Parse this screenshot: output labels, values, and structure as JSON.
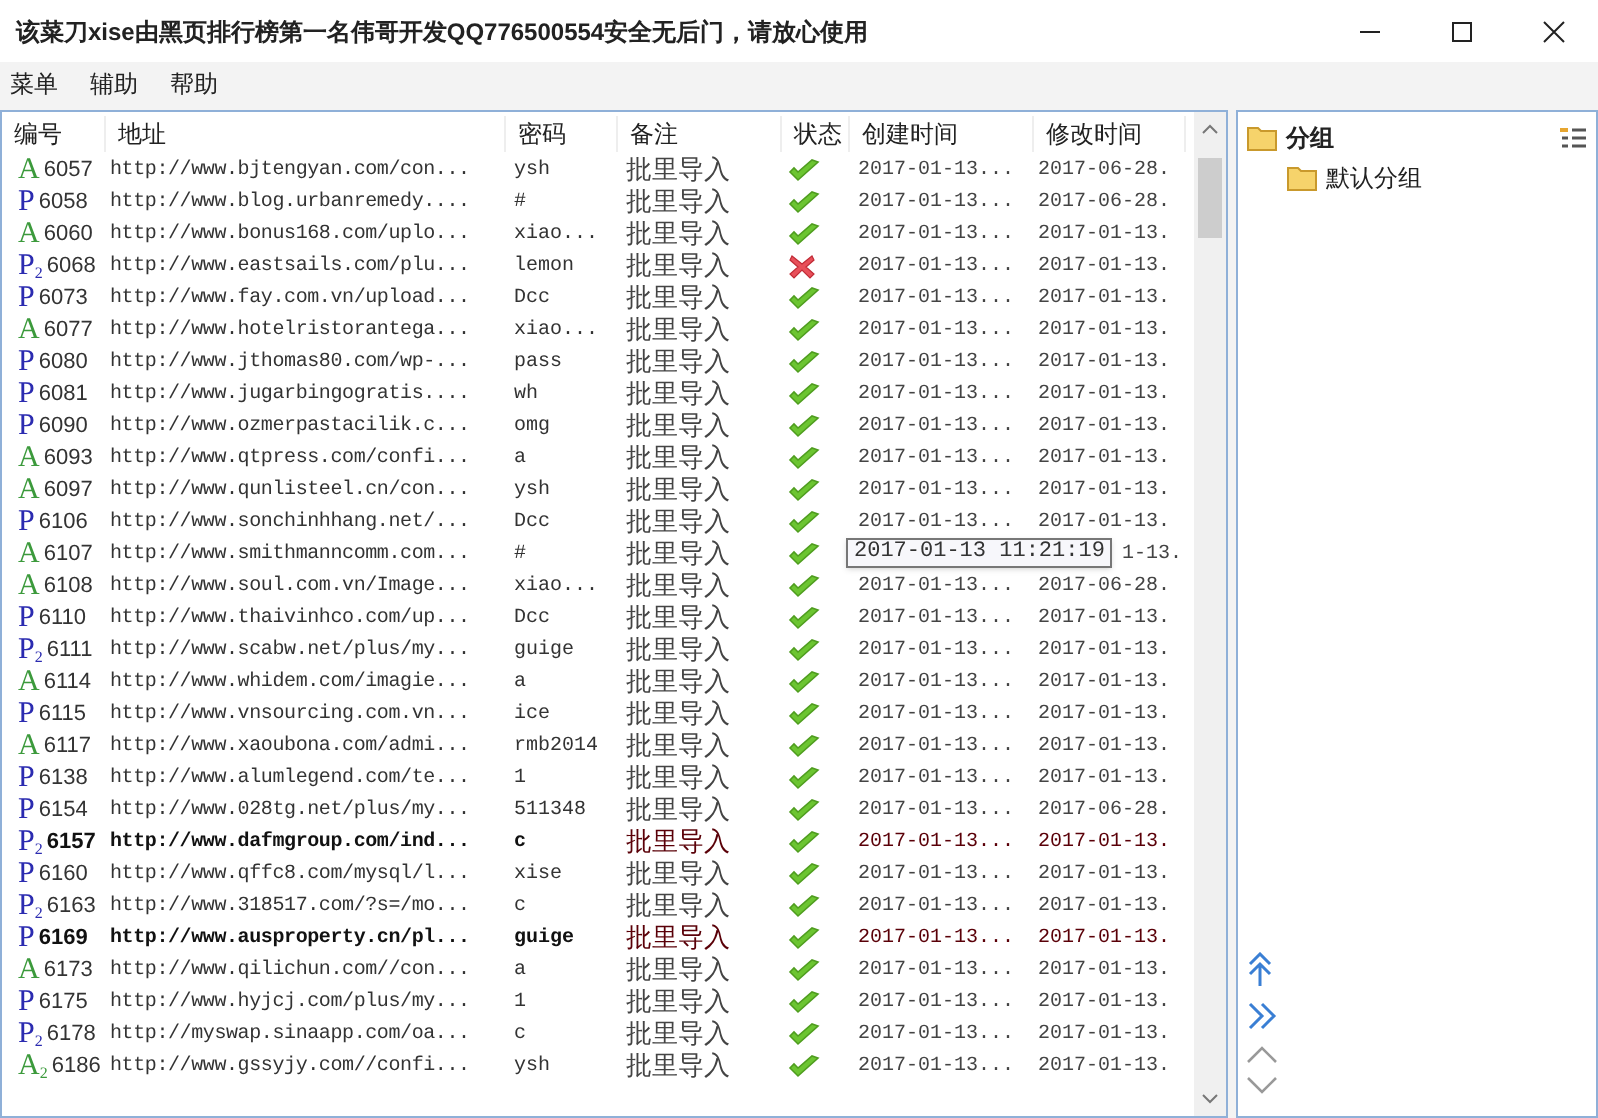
{
  "window": {
    "title": "该菜刀xise由黑页排行榜第一名伟哥开发QQ776500554安全无后门，请放心使用"
  },
  "menu": [
    "菜单",
    "辅助",
    "帮助"
  ],
  "table": {
    "columns": [
      "编号",
      "地址",
      "密码",
      "备注",
      "状态",
      "创建时间",
      "修改时间"
    ],
    "rows": [
      {
        "badge": "A",
        "badge_sub": "",
        "kind": "green",
        "id": "6057",
        "url": "http://www.bjtengyan.com/con...",
        "password": "ysh",
        "note": "批里导入",
        "ok": true,
        "created": "2017-01-13...",
        "modified": "2017-06-28.",
        "bold": false
      },
      {
        "badge": "P",
        "badge_sub": "",
        "kind": "blue",
        "id": "6058",
        "url": "http://www.blog.urbanremedy....",
        "password": "#",
        "note": "批里导入",
        "ok": true,
        "created": "2017-01-13...",
        "modified": "2017-06-28.",
        "bold": false
      },
      {
        "badge": "A",
        "badge_sub": "",
        "kind": "green",
        "id": "6060",
        "url": "http://www.bonus168.com/uplo...",
        "password": "xiao...",
        "note": "批里导入",
        "ok": true,
        "created": "2017-01-13...",
        "modified": "2017-01-13.",
        "bold": false
      },
      {
        "badge": "P",
        "badge_sub": "2",
        "kind": "blue",
        "id": "6068",
        "url": "http://www.eastsails.com/plu...",
        "password": "lemon",
        "note": "批里导入",
        "ok": false,
        "created": "2017-01-13...",
        "modified": "2017-01-13.",
        "bold": false
      },
      {
        "badge": "P",
        "badge_sub": "",
        "kind": "blue",
        "id": "6073",
        "url": "http://www.fay.com.vn/upload...",
        "password": "Dcc",
        "note": "批里导入",
        "ok": true,
        "created": "2017-01-13...",
        "modified": "2017-01-13.",
        "bold": false
      },
      {
        "badge": "A",
        "badge_sub": "",
        "kind": "green",
        "id": "6077",
        "url": "http://www.hotelristorantega...",
        "password": "xiao...",
        "note": "批里导入",
        "ok": true,
        "created": "2017-01-13...",
        "modified": "2017-01-13.",
        "bold": false
      },
      {
        "badge": "P",
        "badge_sub": "",
        "kind": "blue",
        "id": "6080",
        "url": "http://www.jthomas80.com/wp-...",
        "password": "pass",
        "note": "批里导入",
        "ok": true,
        "created": "2017-01-13...",
        "modified": "2017-01-13.",
        "bold": false
      },
      {
        "badge": "P",
        "badge_sub": "",
        "kind": "blue",
        "id": "6081",
        "url": "http://www.jugarbingogratis....",
        "password": "wh",
        "note": "批里导入",
        "ok": true,
        "created": "2017-01-13...",
        "modified": "2017-01-13.",
        "bold": false
      },
      {
        "badge": "P",
        "badge_sub": "",
        "kind": "blue",
        "id": "6090",
        "url": "http://www.ozmerpastacilik.c...",
        "password": "omg",
        "note": "批里导入",
        "ok": true,
        "created": "2017-01-13...",
        "modified": "2017-01-13.",
        "bold": false
      },
      {
        "badge": "A",
        "badge_sub": "",
        "kind": "green",
        "id": "6093",
        "url": "http://www.qtpress.com/confi...",
        "password": "a",
        "note": "批里导入",
        "ok": true,
        "created": "2017-01-13...",
        "modified": "2017-01-13.",
        "bold": false
      },
      {
        "badge": "A",
        "badge_sub": "",
        "kind": "green",
        "id": "6097",
        "url": "http://www.qunlisteel.cn/con...",
        "password": "ysh",
        "note": "批里导入",
        "ok": true,
        "created": "2017-01-13...",
        "modified": "2017-01-13.",
        "bold": false
      },
      {
        "badge": "P",
        "badge_sub": "",
        "kind": "blue",
        "id": "6106",
        "url": "http://www.sonchinhhang.net/...",
        "password": "Dcc",
        "note": "批里导入",
        "ok": true,
        "created": "2017-01-13...",
        "modified": "2017-01-13.",
        "bold": false
      },
      {
        "badge": "A",
        "badge_sub": "",
        "kind": "green",
        "id": "6107",
        "url": "http://www.smithmanncomm.com...",
        "password": "#",
        "note": "批里导入",
        "ok": true,
        "tooltip": "2017-01-13 11:21:19",
        "modified": "1-13.",
        "bold": false
      },
      {
        "badge": "A",
        "badge_sub": "",
        "kind": "green",
        "id": "6108",
        "url": "http://www.soul.com.vn/Image...",
        "password": "xiao...",
        "note": "批里导入",
        "ok": true,
        "created": "2017-01-13...",
        "modified": "2017-06-28.",
        "bold": false
      },
      {
        "badge": "P",
        "badge_sub": "",
        "kind": "blue",
        "id": "6110",
        "url": "http://www.thaivinhco.com/up...",
        "password": "Dcc",
        "note": "批里导入",
        "ok": true,
        "created": "2017-01-13...",
        "modified": "2017-01-13.",
        "bold": false
      },
      {
        "badge": "P",
        "badge_sub": "2",
        "kind": "blue",
        "id": "6111",
        "url": "http://www.scabw.net/plus/my...",
        "password": "guige",
        "note": "批里导入",
        "ok": true,
        "created": "2017-01-13...",
        "modified": "2017-01-13.",
        "bold": false
      },
      {
        "badge": "A",
        "badge_sub": "",
        "kind": "green",
        "id": "6114",
        "url": "http://www.whidem.com/imagie...",
        "password": "a",
        "note": "批里导入",
        "ok": true,
        "created": "2017-01-13...",
        "modified": "2017-01-13.",
        "bold": false
      },
      {
        "badge": "P",
        "badge_sub": "",
        "kind": "blue",
        "id": "6115",
        "url": "http://www.vnsourcing.com.vn...",
        "password": "ice",
        "note": "批里导入",
        "ok": true,
        "created": "2017-01-13...",
        "modified": "2017-01-13.",
        "bold": false
      },
      {
        "badge": "A",
        "badge_sub": "",
        "kind": "green",
        "id": "6117",
        "url": "http://www.xaoubona.com/admi...",
        "password": "rmb2014",
        "note": "批里导入",
        "ok": true,
        "created": "2017-01-13...",
        "modified": "2017-01-13.",
        "bold": false
      },
      {
        "badge": "P",
        "badge_sub": "",
        "kind": "blue",
        "id": "6138",
        "url": "http://www.alumlegend.com/te...",
        "password": "1",
        "note": "批里导入",
        "ok": true,
        "created": "2017-01-13...",
        "modified": "2017-01-13.",
        "bold": false
      },
      {
        "badge": "P",
        "badge_sub": "",
        "kind": "blue",
        "id": "6154",
        "url": "http://www.028tg.net/plus/my...",
        "password": "511348",
        "note": "批里导入",
        "ok": true,
        "created": "2017-01-13...",
        "modified": "2017-06-28.",
        "bold": false
      },
      {
        "badge": "P",
        "badge_sub": "2",
        "kind": "blue",
        "id": "6157",
        "url": "http://www.dafmgroup.com/ind...",
        "password": "c",
        "note": "批里导入",
        "ok": true,
        "created": "2017-01-13...",
        "modified": "2017-01-13.",
        "bold": true
      },
      {
        "badge": "P",
        "badge_sub": "",
        "kind": "blue",
        "id": "6160",
        "url": "http://www.qffc8.com/mysql/l...",
        "password": "xise",
        "note": "批里导入",
        "ok": true,
        "created": "2017-01-13...",
        "modified": "2017-01-13.",
        "bold": false
      },
      {
        "badge": "P",
        "badge_sub": "2",
        "kind": "blue",
        "id": "6163",
        "url": "http://www.318517.com/?s=/mo...",
        "password": "c",
        "note": "批里导入",
        "ok": true,
        "created": "2017-01-13...",
        "modified": "2017-01-13.",
        "bold": false
      },
      {
        "badge": "P",
        "badge_sub": "",
        "kind": "blue",
        "id": "6169",
        "url": "http://www.ausproperty.cn/pl...",
        "password": "guige",
        "note": "批里导入",
        "ok": true,
        "created": "2017-01-13...",
        "modified": "2017-01-13.",
        "bold": true
      },
      {
        "badge": "A",
        "badge_sub": "",
        "kind": "green",
        "id": "6173",
        "url": "http://www.qilichun.com//con...",
        "password": "a",
        "note": "批里导入",
        "ok": true,
        "created": "2017-01-13...",
        "modified": "2017-01-13.",
        "bold": false
      },
      {
        "badge": "P",
        "badge_sub": "",
        "kind": "blue",
        "id": "6175",
        "url": "http://www.hyjcj.com/plus/my...",
        "password": "1",
        "note": "批里导入",
        "ok": true,
        "created": "2017-01-13...",
        "modified": "2017-01-13.",
        "bold": false
      },
      {
        "badge": "P",
        "badge_sub": "2",
        "kind": "blue",
        "id": "6178",
        "url": "http://myswap.sinaapp.com/oa...",
        "password": "c",
        "note": "批里导入",
        "ok": true,
        "created": "2017-01-13...",
        "modified": "2017-01-13.",
        "bold": false
      },
      {
        "badge": "A",
        "badge_sub": "2",
        "kind": "green",
        "id": "6186",
        "url": "http://www.gssyjy.com//confi...",
        "password": "ysh",
        "note": "批里导入",
        "ok": true,
        "created": "2017-01-13...",
        "modified": "2017-01-13.",
        "bold": false
      }
    ]
  },
  "groups": {
    "label": "分组",
    "children": [
      {
        "label": "默认分组"
      }
    ]
  }
}
